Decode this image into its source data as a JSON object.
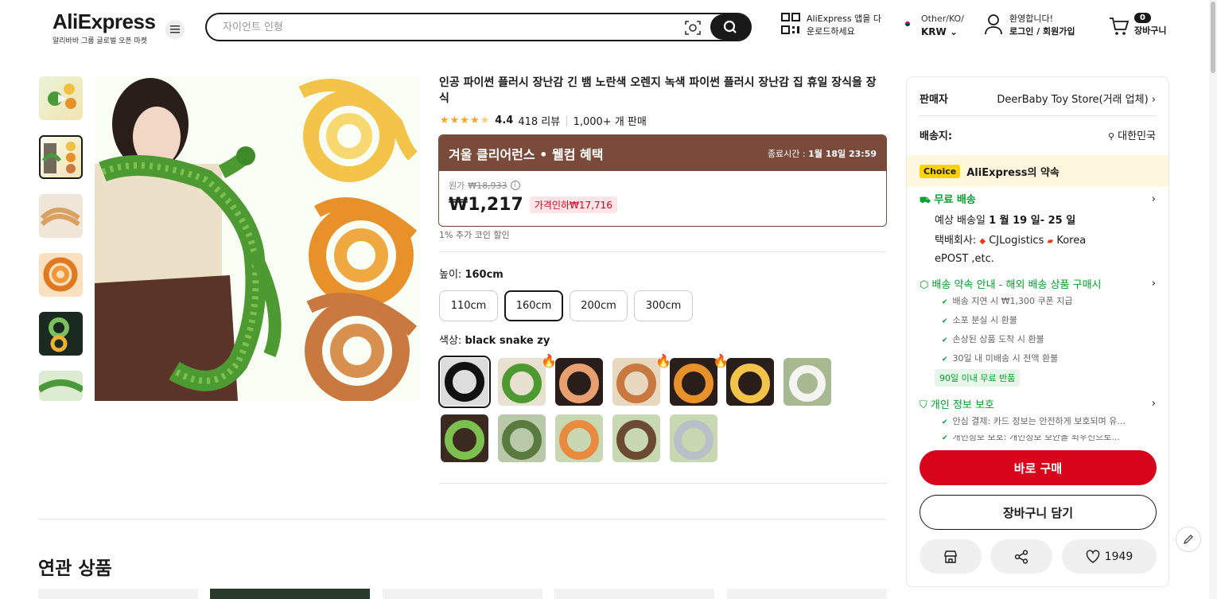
{
  "header": {
    "logo": "AliExpress",
    "logo_sub": "알리바바 그룹 글로벌 오픈 마켓",
    "search_placeholder": "자이언트 인형",
    "app_line1": "AliExpress 앱을 다",
    "app_line2": "운로드하세요",
    "region_line1": "Other/KO/",
    "region_line2": "KRW",
    "account_line1": "환영합니다!",
    "account_line2": "로그인 / 회원가입",
    "cart_count": "0",
    "cart_label": "장바구니"
  },
  "product": {
    "title": "인공 파이썬 플러시 장난감 긴 뱀 노란색 오렌지 녹색 파이썬 플러시 장난감 집 휴일 장식을 장식",
    "rating": "4.4",
    "reviews": "418 리뷰",
    "sold": "1,000+ 개 판매",
    "promo_title": "겨울 클리어런스 • 웰컴 혜택",
    "promo_end": "종료시간 : ",
    "promo_end_date": "1월 18일 23:59",
    "original_label": "원가",
    "original_price": "₩18,933",
    "price": "₩1,217",
    "discount": "가격인하₩17,716",
    "coin": "1% 추가 코인 할인",
    "height_label": "높이: ",
    "height_value": "160cm",
    "sizes": [
      "110cm",
      "160cm",
      "200cm",
      "300cm"
    ],
    "color_label": "색상: ",
    "color_value": "black snake zy"
  },
  "side": {
    "seller_label": "판매자",
    "seller": "DeerBaby Toy Store(거래 업체)",
    "ship_to_label": "배송지:",
    "ship_to": "대한민국",
    "choice_badge": "Choice",
    "choice_text": "AliExpress의 약속",
    "free_ship": "무료 배송",
    "eta_prefix": "예상 배송일 ",
    "eta": "1 월 19 일- 25 일",
    "courier_label": "택배회사: ",
    "courier1": "CJLogistics",
    "courier2": "Korea",
    "courier3": "ePOST ,etc.",
    "guarantee": "배송 약속 안내 - 해외 배송 상품 구매시",
    "g1": "배송 지연 시 ₩1,300 쿠폰 지급",
    "g2": "소포 분실 시 환불",
    "g3": "손상된 상품 도착 시 환불",
    "g4": "30일 내 미배송 시 전액 환불",
    "return_tag": "90일 이내 무료 반품",
    "privacy": "개인 정보 보호",
    "p1": "안심 결제: 카드 정보는 안전하게 보호되며 유...",
    "p2": "개인정보 보호: 개인정보 보안을 최우선으로...",
    "buy": "바로 구매",
    "add_cart": "장바구니 담기",
    "wish_count": "1949"
  },
  "related_title": "연관 상품",
  "colors": {
    "accent": "#d8041b",
    "promo": "#7a4b3a",
    "green": "#00a32a"
  }
}
